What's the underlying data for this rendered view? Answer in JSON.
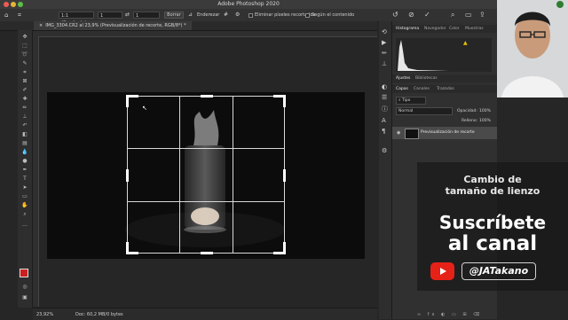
{
  "window": {
    "title": "Adobe Photoshop 2020"
  },
  "options_bar": {
    "ratio_select": "1:1 (Cuadrado)",
    "width_value": "1",
    "height_value": "1",
    "clear_label": "Borrar",
    "straighten_label": "Enderezar",
    "delete_cropped_label": "Eliminar píxeles recortados",
    "content_aware_label": "Según el contenido"
  },
  "document": {
    "tab_label": "IMG_3304.CR2 al 23,9% (Previsualización de recorte, RGB/8*) *"
  },
  "status": {
    "zoom": "23,92%",
    "doc_info": "Doc: 60,2 MB/0 bytes"
  },
  "panels": {
    "top_tabs": [
      "Histograma",
      "Navegador",
      "Color",
      "Muestras"
    ],
    "mid_tabs": [
      "Ajustes",
      "Bibliotecas"
    ],
    "layer_tabs": [
      "Capas",
      "Canales",
      "Trazados"
    ],
    "blend_mode": "Normal",
    "opacity_label": "Opacidad:",
    "opacity_value": "100%",
    "fill_label": "Relleno:",
    "fill_value": "100%",
    "layer_name": "Previsualización de recorte"
  },
  "overlay": {
    "caption_line1": "Cambio de",
    "caption_line2": "tamaño de lienzo",
    "subscribe_line1": "Suscríbete",
    "subscribe_line2": "al canal",
    "handle": "@JATakano"
  },
  "colors": {
    "accent": "#3a6fd8",
    "youtube_red": "#e62117",
    "foreground_swatch": "#cc1f1f",
    "background_swatch": "#ffffff"
  }
}
